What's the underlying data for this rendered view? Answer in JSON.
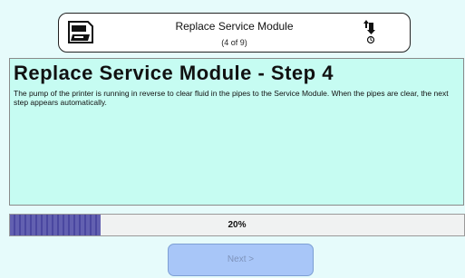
{
  "header": {
    "title": "Replace Service Module",
    "subtitle": "(4 of 9)",
    "left_icon": "printer-icon",
    "right_icon": "ink-flow-icon"
  },
  "step": {
    "title": "Replace Service Module - Step 4",
    "description": "The pump of the printer is running in reverse to clear fluid in the pipes to the Service Module. When the pipes are clear, the next step appears automatically."
  },
  "progress": {
    "value": 0.2,
    "label": "20%"
  },
  "actions": {
    "next_label": "Next >"
  },
  "colors": {
    "background": "#e6fbfb",
    "panel": "#c6fcf2",
    "progress_fill": "#5553a8",
    "next_button": "#a8c6f8"
  }
}
